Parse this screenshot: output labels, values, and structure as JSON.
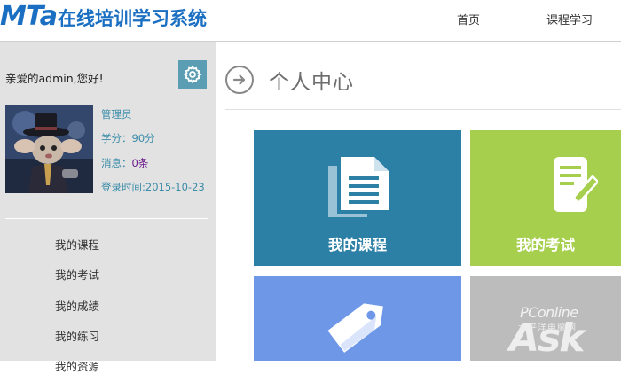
{
  "header": {
    "logo_mark": "MTa",
    "logo_text": "在线培训学习系统",
    "nav": [
      {
        "label": "首页"
      },
      {
        "label": "课程学习"
      }
    ]
  },
  "sidebar": {
    "greeting": "亲爱的admin,您好!",
    "settings_icon": "gear-icon",
    "role": "管理员",
    "score": "学分：90分",
    "messages_prefix": "消息：",
    "messages_count": "0条",
    "login_time": "登录时间:2015-10-23",
    "menu": [
      {
        "label": "我的课程"
      },
      {
        "label": "我的考试"
      },
      {
        "label": "我的成绩"
      },
      {
        "label": "我的练习"
      },
      {
        "label": "我的资源"
      }
    ]
  },
  "main": {
    "title": "个人中心",
    "title_icon": "arrow-right-circle-icon",
    "tiles": [
      {
        "label": "我的课程",
        "icon": "document-icon",
        "color": "#2c7fa5"
      },
      {
        "label": "我的考试",
        "icon": "edit-icon",
        "color": "#a5cf4c"
      },
      {
        "label": "",
        "icon": "tag-icon",
        "color": "#6e97e8"
      },
      {
        "label": "",
        "icon": "",
        "color": "#bcbcbc"
      }
    ]
  },
  "watermark": {
    "brand": "PConline",
    "sub": "太平洋电脑网",
    "ask": "Ask"
  },
  "colors": {
    "brand": "#1a6fc2",
    "sidebar_bg": "#e2e2e2",
    "info_text": "#3a8ca8"
  }
}
